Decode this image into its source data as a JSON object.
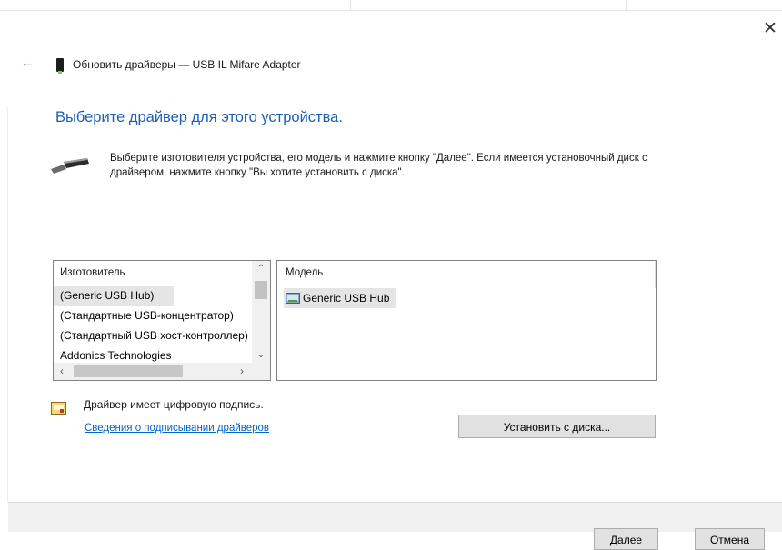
{
  "window": {
    "title": "Обновить драйверы — USB IL Mifare Adapter",
    "close_glyph": "✕",
    "back_glyph": "←"
  },
  "page": {
    "heading": "Выберите драйвер для этого устройства.",
    "instruction": "Выберите изготовителя устройства, его модель и нажмите кнопку \"Далее\". Если имеется установочный диск с  драйвером, нажмите кнопку \"Вы хотите установить с диска\"."
  },
  "manufacturers": {
    "header": "Изготовитель",
    "items": [
      "(Generic USB Hub)",
      "(Стандартные USB-концентратор)",
      "(Стандартный USB хост-контроллер)",
      "Addonics Technologies"
    ],
    "selected_index": 0
  },
  "models": {
    "header": "Модель",
    "items": [
      "Generic USB Hub"
    ]
  },
  "signature": {
    "text": "Драйвер имеет цифровую подпись.",
    "link": "Сведения о подписывании драйверов"
  },
  "buttons": {
    "have_disk": "Установить с диска...",
    "next": "Далее",
    "cancel": "Отмена"
  },
  "colors": {
    "heading": "#1f5fb2",
    "link": "#0066cc",
    "selection": "#e5e5e5",
    "footer": "#f0f0f0"
  }
}
